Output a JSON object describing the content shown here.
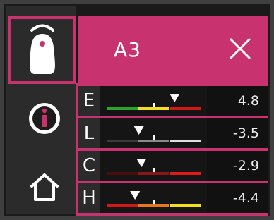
{
  "header": {
    "title": "A3"
  },
  "rows": [
    {
      "letter": "E",
      "value": "4.8",
      "palette": [
        "#28a82a",
        "#f2df1e",
        "#d11919"
      ]
    },
    {
      "letter": "L",
      "value": "-3.5",
      "palette": [
        "#3a3a3a",
        "#8a8a8a",
        "#e0e0e0"
      ]
    },
    {
      "letter": "C",
      "value": "-2.9",
      "palette": [
        "#4a0d0d",
        "#8a1616",
        "#e01818"
      ]
    },
    {
      "letter": "H",
      "value": "-4.4",
      "palette": [
        "#d11919",
        "#e8761c",
        "#f2df1e"
      ]
    }
  ],
  "icons": {
    "sidebar": [
      "tooth-icon",
      "info-icon",
      "home-icon"
    ],
    "header": "close-icon"
  },
  "colors": {
    "accent": "#c8336f",
    "background": "#2b2b2b"
  }
}
